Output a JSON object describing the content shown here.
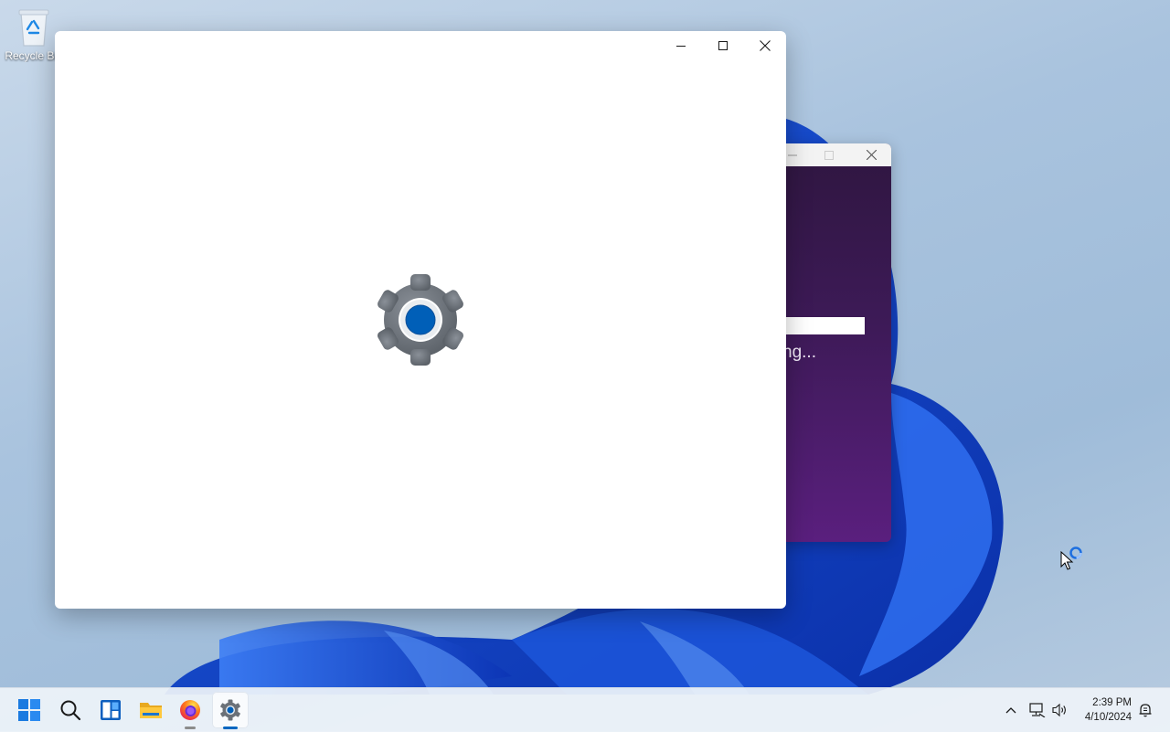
{
  "desktop": {
    "icons": [
      {
        "label": "Recycle Bin",
        "icon": "recycle-bin-icon"
      }
    ]
  },
  "settings_window": {
    "title": "",
    "state": "loading",
    "splash_icon": "settings-gear-icon",
    "buttons": {
      "minimize": "minimize-icon",
      "maximize": "maximize-icon",
      "close": "close-icon"
    }
  },
  "background_window": {
    "status_text": "ng...",
    "buttons": {
      "minimize": "minimize-icon",
      "maximize": "maximize-icon",
      "close": "close-icon"
    }
  },
  "taskbar": {
    "items": [
      {
        "name": "start",
        "icon": "windows-start-icon"
      },
      {
        "name": "search",
        "icon": "search-icon"
      },
      {
        "name": "widgets",
        "icon": "widgets-icon"
      },
      {
        "name": "file-explorer",
        "icon": "folder-icon"
      },
      {
        "name": "firefox",
        "icon": "firefox-icon"
      },
      {
        "name": "settings",
        "icon": "settings-gear-icon",
        "active": true
      }
    ],
    "tray": {
      "overflow_icon": "chevron-up-icon",
      "network_icon": "network-icon",
      "volume_icon": "volume-icon",
      "notification_icon": "notification-icon"
    },
    "clock": {
      "time": "2:39 PM",
      "date": "4/10/2024"
    }
  },
  "colors": {
    "accent": "#0067c0",
    "gear_gray": "#6b7178",
    "gear_center": "#005fb8",
    "bg_window_purple": "#5a1f7e"
  }
}
